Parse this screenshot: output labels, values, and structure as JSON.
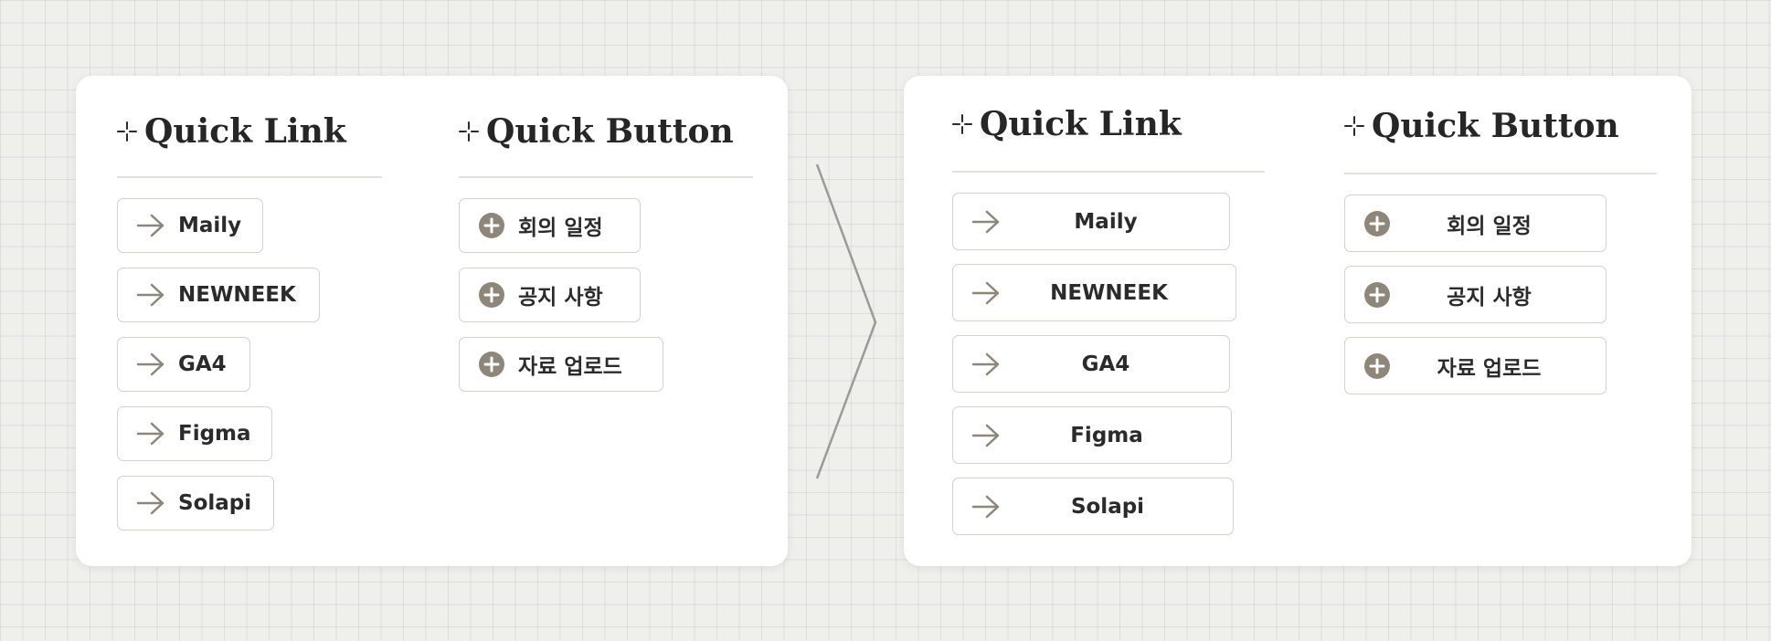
{
  "before": {
    "link_title": "Quick Link",
    "button_title": "Quick Button",
    "links": [
      "Maily",
      "NEWNEEK",
      "GA4",
      "Figma",
      "Solapi"
    ],
    "buttons": [
      "회의 일정",
      "공지 사항",
      "자료 업로드"
    ]
  },
  "after": {
    "link_title": "Quick Link",
    "button_title": "Quick Button",
    "links": [
      "Maily",
      "NEWNEEK",
      "GA4",
      "Figma",
      "Solapi"
    ],
    "buttons": [
      "회의 일정",
      "공지 사항",
      "자료 업로드"
    ]
  },
  "icons": {
    "heading": "sparkle-icon",
    "link": "arrow-right-icon",
    "button": "plus-circle-icon",
    "divider": "chevron-right-icon"
  },
  "colors": {
    "icon": "#8d8679",
    "text": "#2b2b2b",
    "border": "#d2d2cd"
  }
}
